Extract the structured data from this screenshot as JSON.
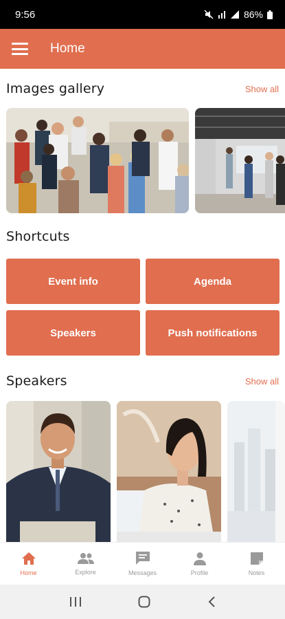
{
  "status_bar": {
    "time": "9:56",
    "battery": "86%"
  },
  "app_bar": {
    "title": "Home",
    "menu_icon": "hamburger-menu-icon"
  },
  "gallery": {
    "title": "Images gallery",
    "show_all": "Show all"
  },
  "shortcuts": {
    "title": "Shortcuts",
    "items": [
      {
        "label": "Event info"
      },
      {
        "label": "Agenda"
      },
      {
        "label": "Speakers"
      },
      {
        "label": "Push notifications"
      }
    ]
  },
  "speakers": {
    "title": "Speakers",
    "show_all": "Show all"
  },
  "bottom_nav": {
    "items": [
      {
        "label": "Home",
        "icon": "home-icon",
        "active": true
      },
      {
        "label": "Explore",
        "icon": "people-icon"
      },
      {
        "label": "Messages",
        "icon": "message-icon"
      },
      {
        "label": "Profile",
        "icon": "person-icon"
      },
      {
        "label": "Notes",
        "icon": "note-icon"
      }
    ]
  },
  "colors": {
    "accent": "#E06E4F",
    "status_bar": "#000000"
  }
}
